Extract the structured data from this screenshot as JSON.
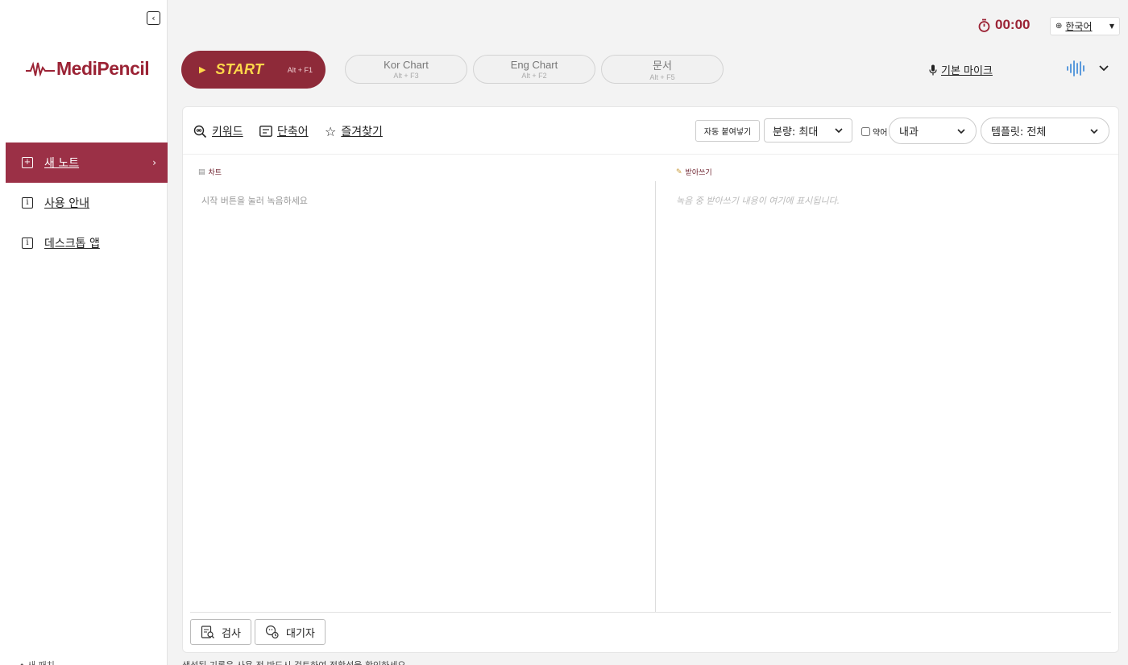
{
  "sidebar": {
    "logo_text": "MediPencil",
    "items": [
      {
        "label": "새 노트",
        "icon": "plus-box-icon"
      },
      {
        "label": "사용 안내",
        "icon": "info-icon"
      },
      {
        "label": "데스크톱 앱",
        "icon": "info-icon"
      }
    ],
    "bottom_text": "• 새 패치"
  },
  "header": {
    "timer": "00:00",
    "language": "한국어",
    "start": {
      "label": "START",
      "shortcut": "Alt + F1"
    },
    "modes": [
      {
        "label": "Kor Chart",
        "shortcut": "Alt + F3"
      },
      {
        "label": "Eng Chart",
        "shortcut": "Alt + F2"
      },
      {
        "label": "문서",
        "shortcut": "Alt + F5"
      }
    ],
    "mic_label": "기본 마이크"
  },
  "toolbar": {
    "keyword": "키워드",
    "shortcut": "단축어",
    "favorites": "즐겨찾기",
    "auto_paste": "자동 붙여넣기",
    "amount": "분량: 최대",
    "abbreviation": "약어",
    "department": "내과",
    "template": "템플릿: 전체"
  },
  "content": {
    "chart_title": "차트",
    "chart_placeholder": "시작 버튼을 눌러 녹음하세요",
    "dictation_title": "받아쓰기",
    "dictation_placeholder": "녹음 중 받아쓰기 내용이 여기에 표시됩니다."
  },
  "footer": {
    "exam_button": "검사",
    "waitlist_button": "대기자",
    "notice": "생성된 기록은 사용 전 반드시 검토하여 정확성을 확인하세요."
  },
  "colors": {
    "brand": "#9b2335",
    "start_bg": "#8e2a39",
    "start_text": "#ffd84a",
    "wave": "#4a90d9"
  }
}
